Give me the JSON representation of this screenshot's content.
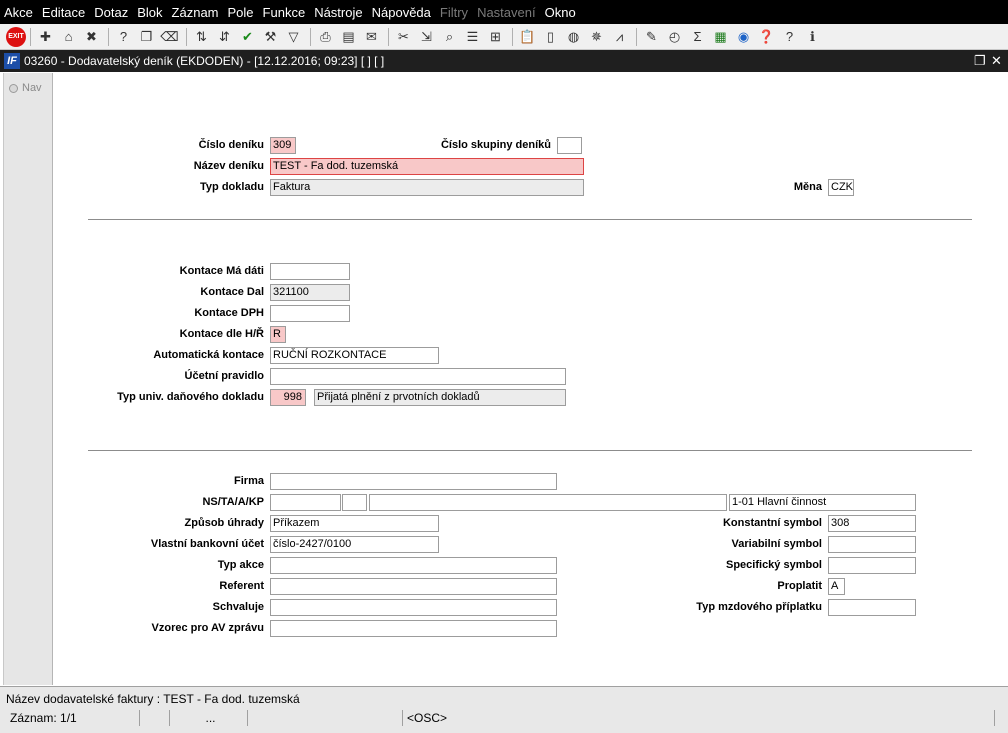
{
  "menu": [
    "Akce",
    "Editace",
    "Dotaz",
    "Blok",
    "Záznam",
    "Pole",
    "Funkce",
    "Nástroje",
    "Nápověda",
    "Filtry",
    "Nastavení",
    "Okno"
  ],
  "menu_disabled": [
    "Filtry",
    "Nastavení"
  ],
  "toolbar": {
    "exit_label": "EXIT"
  },
  "window": {
    "title": "03260 - Dodavatelský deník (EKDODEN) - [12.12.2016; 09:23]  [ ] [ ]",
    "icon_text": "IF"
  },
  "nav": {
    "label": "Nav"
  },
  "form": {
    "cislo_deniku": {
      "label": "Číslo deníku",
      "value": "309"
    },
    "cislo_skupiny": {
      "label": "Číslo skupiny deníků",
      "value": ""
    },
    "nazev_deniku": {
      "label": "Název deníku",
      "value": "TEST - Fa dod. tuzemská"
    },
    "typ_dokladu": {
      "label": "Typ dokladu",
      "value": "Faktura"
    },
    "mena": {
      "label": "Měna",
      "value": "CZK"
    },
    "kontace_ma_dati": {
      "label": "Kontace Má dáti",
      "value": ""
    },
    "kontace_dal": {
      "label": "Kontace Dal",
      "value": "321100"
    },
    "kontace_dph": {
      "label": "Kontace DPH",
      "value": ""
    },
    "kontace_dle_hr": {
      "label": "Kontace dle H/Ř",
      "value": "R"
    },
    "automaticka_kontace": {
      "label": "Automatická kontace",
      "value": "RUČNÍ ROZKONTACE"
    },
    "ucetni_pravidlo": {
      "label": "Účetní pravidlo",
      "value": ""
    },
    "typ_univ": {
      "label": "Typ univ. daňového dokladu",
      "value": "998",
      "desc": "Přijatá plnění z prvotních dokladů"
    },
    "firma": {
      "label": "Firma",
      "value": ""
    },
    "ns_ta_a_kp": {
      "label": "NS/TA/A/KP",
      "v1": "",
      "v2": "",
      "v3": "",
      "v4": "1-01 Hlavní činnost"
    },
    "zpusob_uhrady": {
      "label": "Způsob úhrady",
      "value": "Příkazem"
    },
    "vlastni_ucet": {
      "label": "Vlastní bankovní účet",
      "value": "číslo-2427/0100"
    },
    "typ_akce": {
      "label": "Typ akce",
      "value": ""
    },
    "referent": {
      "label": "Referent",
      "value": ""
    },
    "schvaluje": {
      "label": "Schvaluje",
      "value": ""
    },
    "vzorec": {
      "label": "Vzorec pro AV zprávu",
      "value": ""
    },
    "konstantni_symbol": {
      "label": "Konstantní symbol",
      "value": "308"
    },
    "variabilni_symbol": {
      "label": "Variabilní symbol",
      "value": ""
    },
    "specificky_symbol": {
      "label": "Specifický symbol",
      "value": ""
    },
    "proplatit": {
      "label": "Proplatit",
      "value": "A"
    },
    "typ_mzdoveho": {
      "label": "Typ mzdového příplatku",
      "value": ""
    }
  },
  "status": {
    "hint": "Název dodavatelské faktury : TEST - Fa dod. tuzemská",
    "record": "Záznam: 1/1",
    "c3": "...",
    "c5": "<OSC>"
  }
}
